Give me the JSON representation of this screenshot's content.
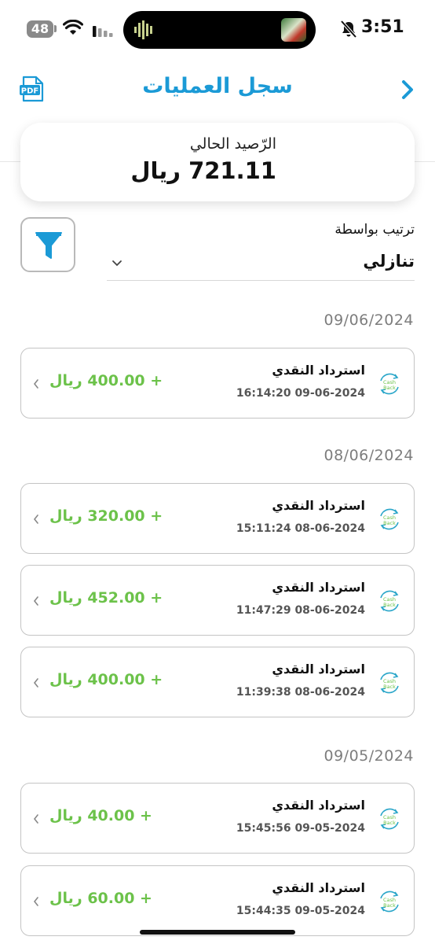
{
  "status": {
    "time": "3:51",
    "battery": "48"
  },
  "header": {
    "title": "سجل العمليات",
    "pdf_label": "PDF"
  },
  "balance": {
    "label": "الرّصيد الحالي",
    "value": "721.11 ريال"
  },
  "sort": {
    "label": "ترتيب بواسطة",
    "value": "تنازلي"
  },
  "groups": [
    {
      "date": "09/06/2024",
      "items": [
        {
          "title": "استرداد النقدي",
          "time": "16:14:20 09-06-2024",
          "amount": "+ 400.00 ريال"
        }
      ]
    },
    {
      "date": "08/06/2024",
      "items": [
        {
          "title": "استرداد النقدي",
          "time": "15:11:24 08-06-2024",
          "amount": "+ 320.00 ريال"
        },
        {
          "title": "استرداد النقدي",
          "time": "11:47:29 08-06-2024",
          "amount": "+ 452.00 ريال"
        },
        {
          "title": "استرداد النقدي",
          "time": "11:39:38 08-06-2024",
          "amount": "+ 400.00 ريال"
        }
      ]
    },
    {
      "date": "09/05/2024",
      "items": [
        {
          "title": "استرداد النقدي",
          "time": "15:45:56 09-05-2024",
          "amount": "+ 40.00 ريال"
        },
        {
          "title": "استرداد النقدي",
          "time": "15:44:35 09-05-2024",
          "amount": "+ 60.00 ريال"
        }
      ]
    }
  ],
  "cashback_icon": {
    "line1": "Cash",
    "line2": "Back"
  },
  "colors": {
    "accent": "#1b9ad6",
    "amount": "#6cc24a",
    "cashback": "#2aa6c9"
  }
}
